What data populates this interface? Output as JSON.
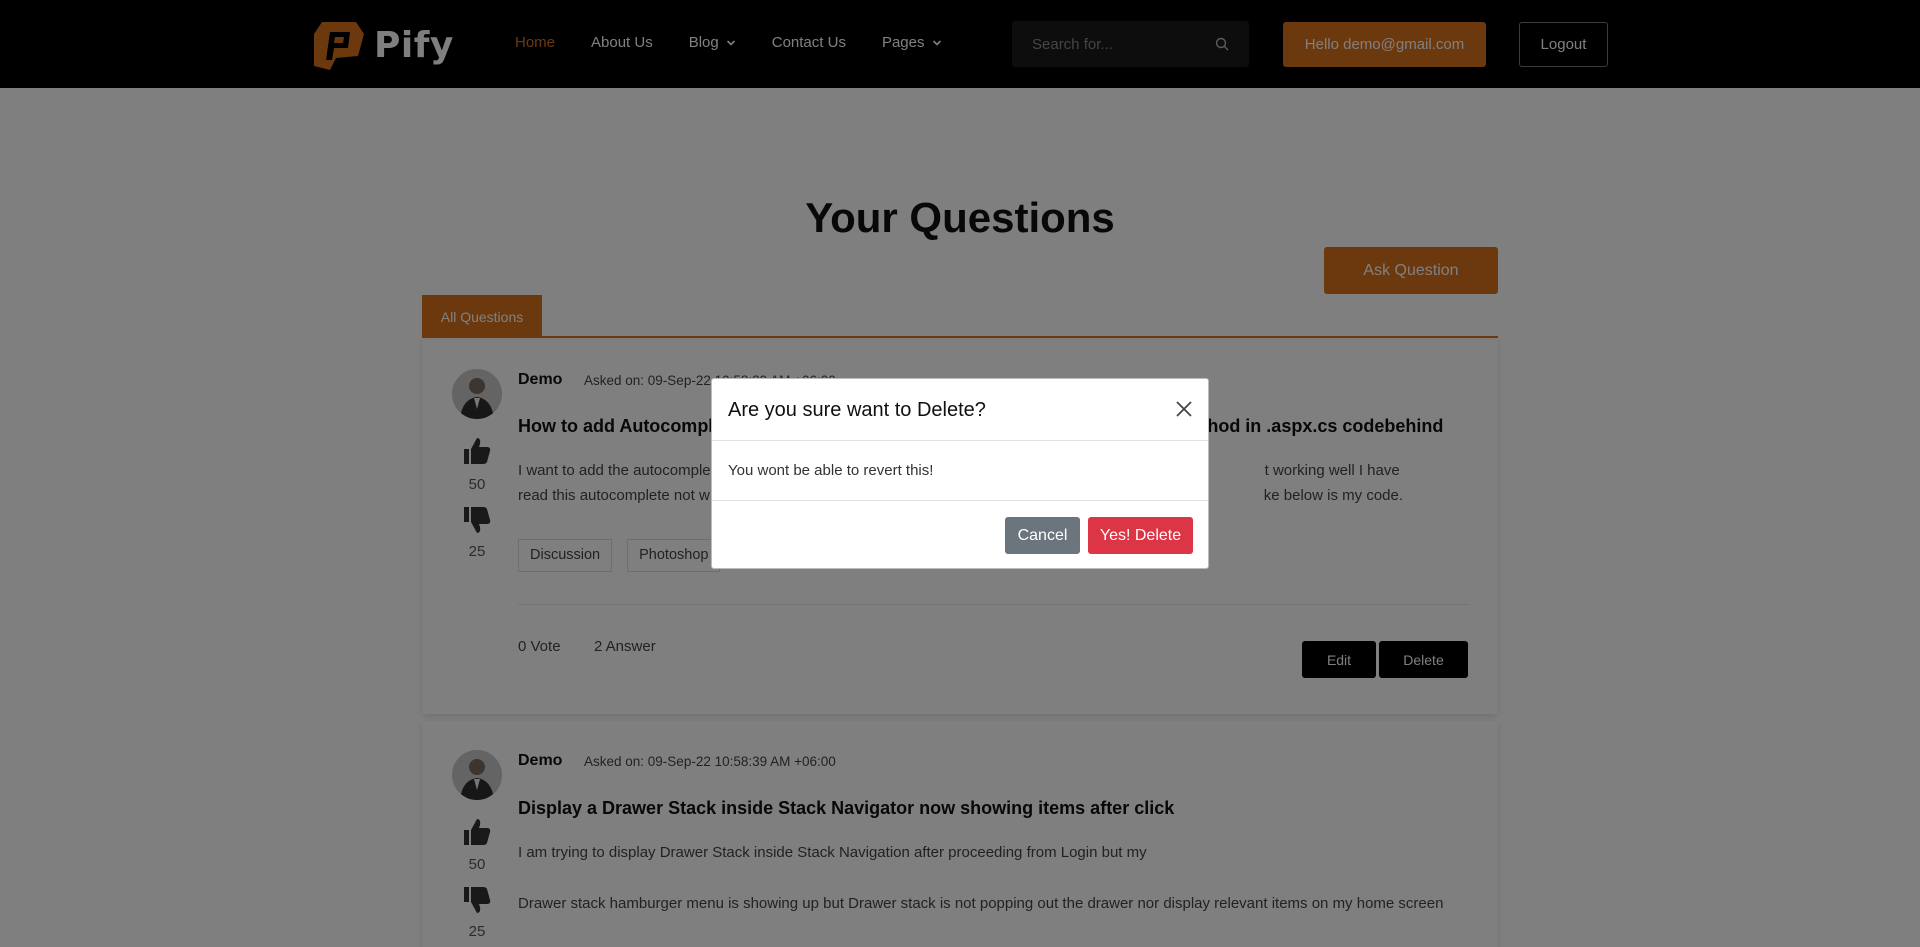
{
  "header": {
    "brand": "Pify",
    "nav": [
      {
        "label": "Home",
        "active": true
      },
      {
        "label": "About Us"
      },
      {
        "label": "Blog"
      },
      {
        "label": "Contact Us"
      },
      {
        "label": "Pages"
      }
    ],
    "search_placeholder": "Search for...",
    "hello_label": "Hello demo@gmail.com",
    "logout_label": "Logout"
  },
  "main": {
    "title": "Your Questions",
    "ask_label": "Ask Question",
    "tab_label": "All Questions",
    "questions": [
      {
        "author": "Demo",
        "asked": "Asked on: 09-Sep-22 10:58:39 AM +06:00",
        "title": "How to add Autocomplete textbox in asp.net using jquery web method in .aspx.cs codebehind",
        "title_left": "How to add Autocomple",
        "title_right": "thod in .aspx.cs codebehind",
        "body_1_left": "I want to add the autocomple",
        "body_1_right": "t working well I have",
        "body_2_left": "read this autocomplete not w",
        "body_2_right": "ke below is my code.",
        "tags": [
          "Discussion",
          "Photoshop"
        ],
        "upvotes": "50",
        "downvotes": "25",
        "votes": "0 Vote",
        "answers": "2 Answer",
        "edit_label": "Edit",
        "delete_label": "Delete"
      },
      {
        "author": "Demo",
        "asked": "Asked on: 09-Sep-22 10:58:39 AM +06:00",
        "title": "Display a Drawer Stack inside Stack Navigator now showing items after click",
        "body_1": "I am trying to display Drawer Stack inside Stack Navigation after proceeding from Login but my",
        "body_2": "Drawer stack hamburger menu is showing up but Drawer stack is not popping out the drawer nor display relevant items on my home screen",
        "upvotes": "50",
        "downvotes": "25"
      }
    ]
  },
  "modal": {
    "title": "Are you sure want to Delete?",
    "text": "You wont be able to revert this!",
    "cancel_label": "Cancel",
    "confirm_label": "Yes! Delete"
  },
  "colors": {
    "accent": "#d9731d",
    "danger": "#dc3545",
    "secondary": "#6c757d"
  }
}
